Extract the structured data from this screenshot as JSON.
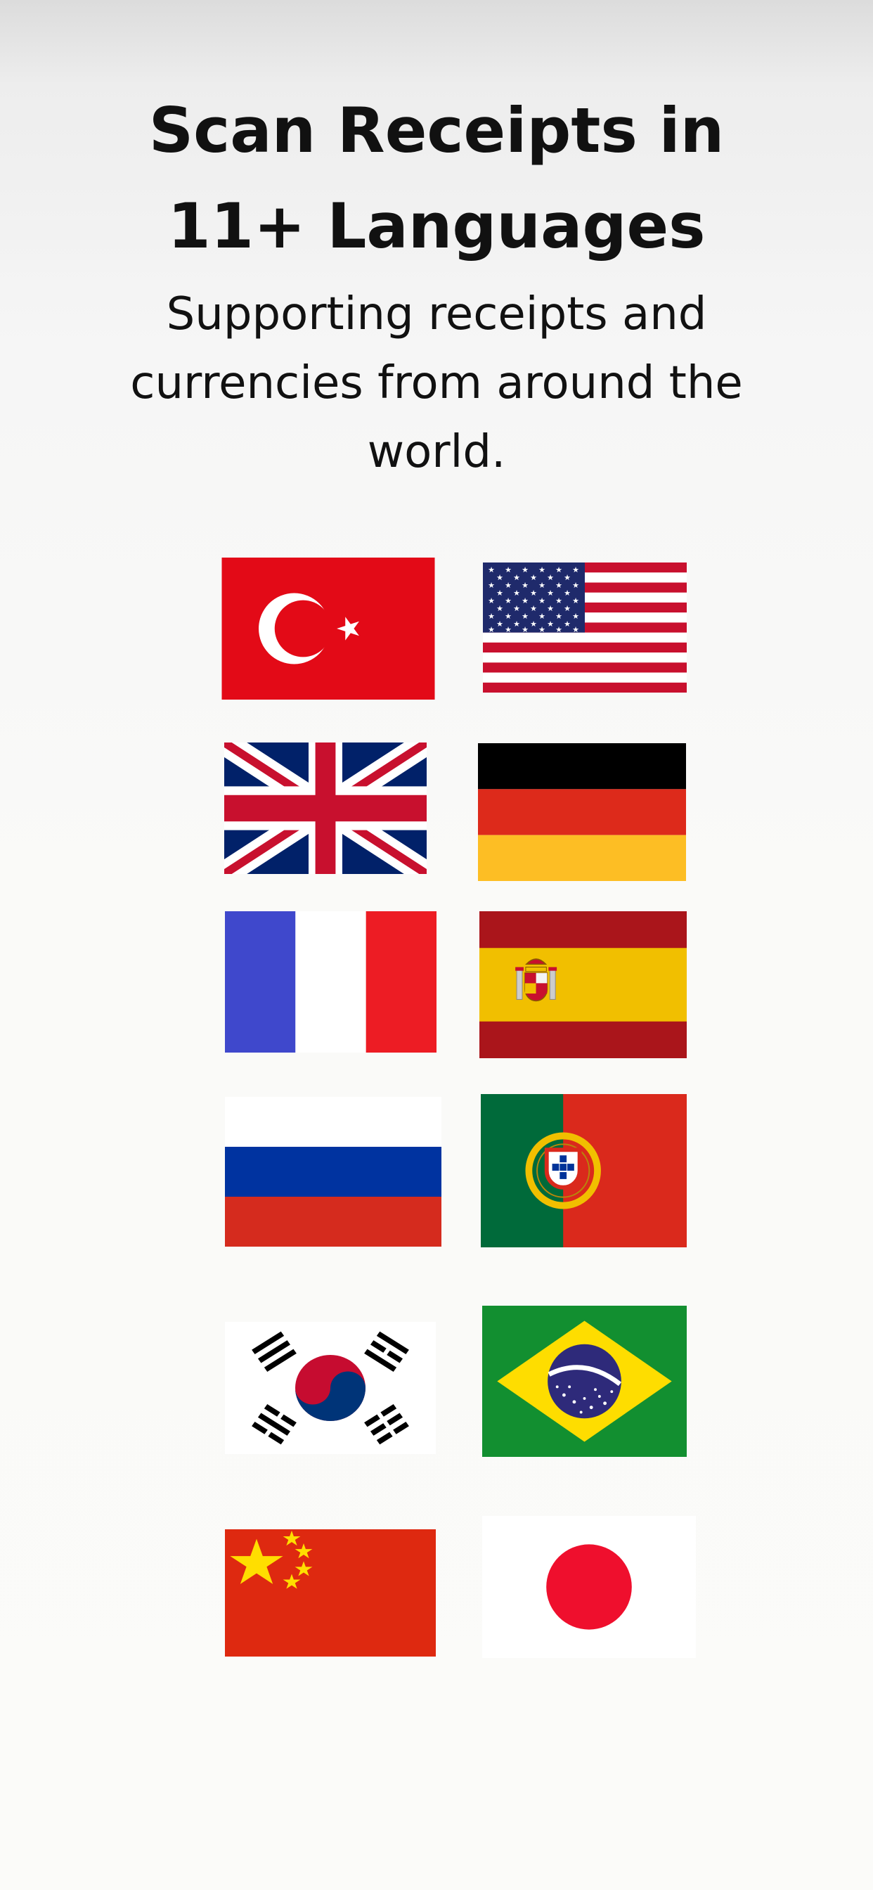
{
  "title_line1": "Scan Receipts in",
  "title_line2": "11+ Languages",
  "subtitle": "Supporting receipts and currencies from around the world.",
  "flags": [
    {
      "country": "Turkey",
      "icon": "turkey-flag-icon"
    },
    {
      "country": "United States",
      "icon": "usa-flag-icon"
    },
    {
      "country": "United Kingdom",
      "icon": "uk-flag-icon"
    },
    {
      "country": "Germany",
      "icon": "germany-flag-icon"
    },
    {
      "country": "France",
      "icon": "france-flag-icon"
    },
    {
      "country": "Spain",
      "icon": "spain-flag-icon"
    },
    {
      "country": "Russia",
      "icon": "russia-flag-icon"
    },
    {
      "country": "Portugal",
      "icon": "portugal-flag-icon"
    },
    {
      "country": "South Korea",
      "icon": "south-korea-flag-icon"
    },
    {
      "country": "Brazil",
      "icon": "brazil-flag-icon"
    },
    {
      "country": "China",
      "icon": "china-flag-icon"
    },
    {
      "country": "Japan",
      "icon": "japan-flag-icon"
    }
  ],
  "colors": {
    "text": "#111111",
    "turkey_red": "#e30a17",
    "usa_red": "#c8102e",
    "usa_blue": "#1f2a6b",
    "uk_blue": "#012169",
    "germany_black": "#000000",
    "germany_red": "#dd2a1b",
    "germany_gold": "#fdbe24",
    "france_blue": "#3f48cc",
    "france_red": "#ed1c24",
    "spain_red": "#aa151b",
    "spain_yellow": "#f1bf00",
    "russia_blue": "#0033a0",
    "russia_red": "#d52b1e",
    "portugal_green": "#006a3a",
    "portugal_red": "#da291c",
    "korea_red": "#c60c30",
    "korea_blue": "#003478",
    "brazil_green": "#128f30",
    "brazil_yellow": "#fedd00",
    "brazil_blue": "#2e2a7a",
    "china_red": "#de2910",
    "china_yellow": "#ffde00",
    "japan_red": "#ef0f2d"
  }
}
